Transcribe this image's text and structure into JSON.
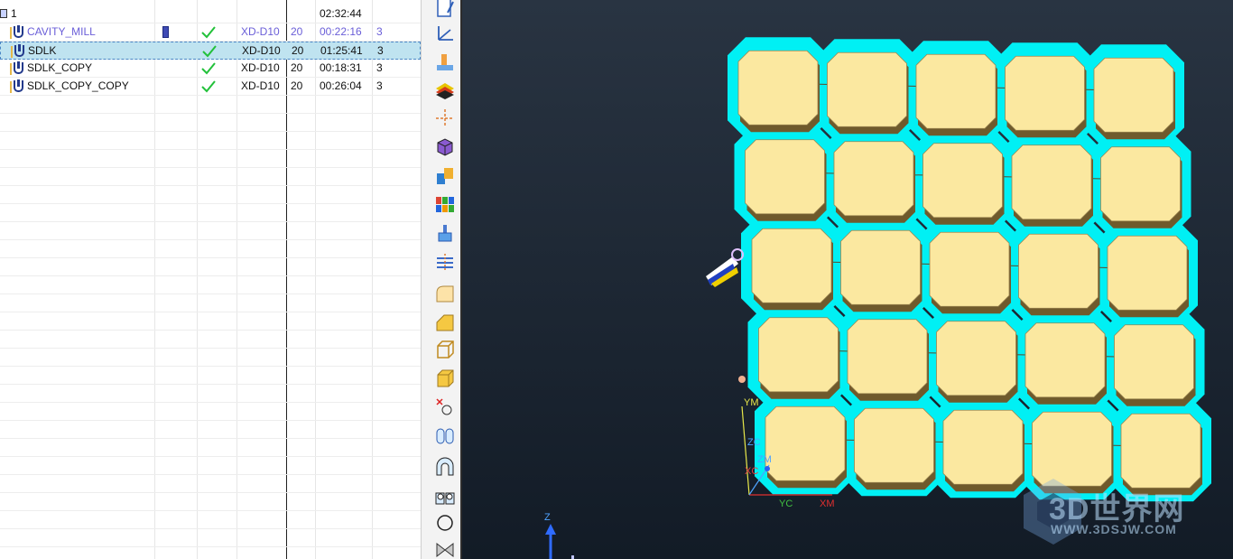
{
  "navigator": {
    "root_row": {
      "name": "1",
      "time": "02:32:44"
    },
    "operations": [
      {
        "name": "CAVITY_MILL",
        "tool": "XD-D10",
        "num": "20",
        "time": "00:22:16",
        "extra": "3",
        "linked": true,
        "selected": false,
        "generated": true
      },
      {
        "name": "SDLK",
        "tool": "XD-D10",
        "num": "20",
        "time": "01:25:41",
        "extra": "3",
        "linked": false,
        "selected": true,
        "generated": false
      },
      {
        "name": "SDLK_COPY",
        "tool": "XD-D10",
        "num": "20",
        "time": "00:18:31",
        "extra": "3",
        "linked": false,
        "selected": false,
        "generated": false
      },
      {
        "name": "SDLK_COPY_COPY",
        "tool": "XD-D10",
        "num": "20",
        "time": "00:26:04",
        "extra": "3",
        "linked": false,
        "selected": false,
        "generated": false
      }
    ],
    "check_color": "#22c13a"
  },
  "toolbar": {
    "icons": [
      "doc-edit-icon",
      "axis-icon",
      "machine-icon",
      "layers-icon",
      "crosshair-icon",
      "cube-view-icon",
      "color-blocks-icon",
      "grid-colors-icon",
      "brush-icon",
      "stack-align-icon",
      "fillet-icon",
      "chamfer-icon",
      "wire-box-icon",
      "solid-box-icon",
      "point-circle-icon",
      "cylinders-icon",
      "arch-icon",
      "double-arch-icon",
      "circle-icon",
      "bowtie-icon"
    ]
  },
  "viewport": {
    "wcs_labels": {
      "ym": "YM",
      "zc": "ZC",
      "zm": "ZM",
      "xc": "XC",
      "yc": "YC",
      "xm": "XM"
    },
    "world_axis_label": "Z",
    "watermark": {
      "title": "3D世界网",
      "url": "WWW.3DSJW.COM"
    },
    "colors": {
      "stock": "#00f0f4",
      "part": "#fbe8a0",
      "part_side": "#6f5a2c",
      "background": "#1a2333"
    }
  }
}
